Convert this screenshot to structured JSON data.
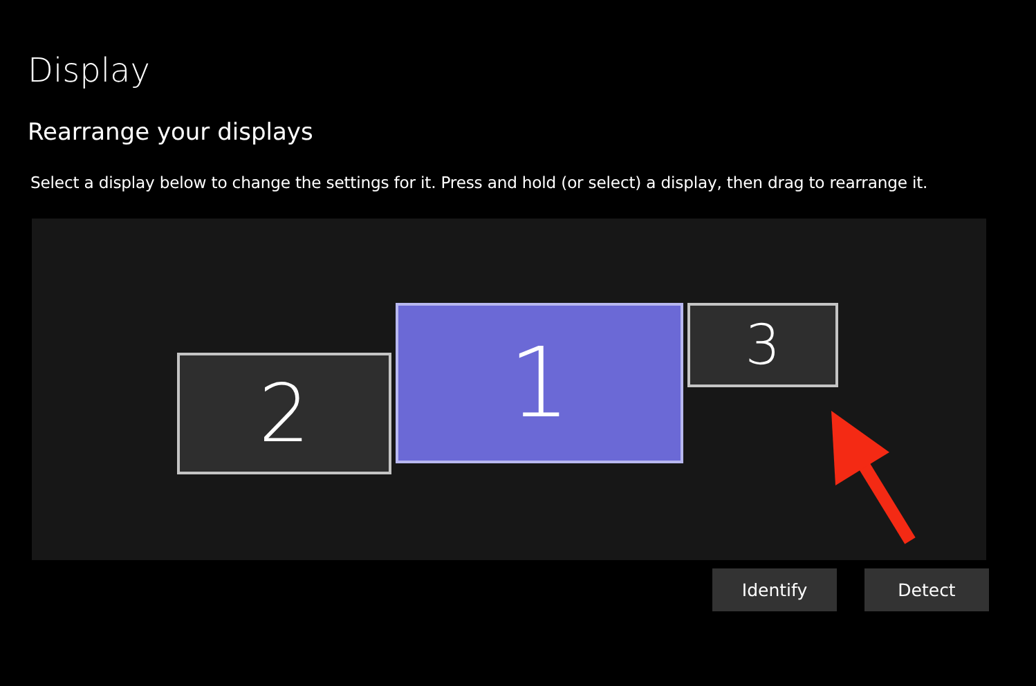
{
  "page": {
    "title": "Display",
    "section": "Rearrange your displays",
    "description": "Select a display below to change the settings for it. Press and hold (or select) a display, then drag to rearrange it."
  },
  "displays": [
    {
      "label": "2",
      "selected": false
    },
    {
      "label": "1",
      "selected": true
    },
    {
      "label": "3",
      "selected": false
    }
  ],
  "buttons": [
    "Identify",
    "Detect"
  ]
}
